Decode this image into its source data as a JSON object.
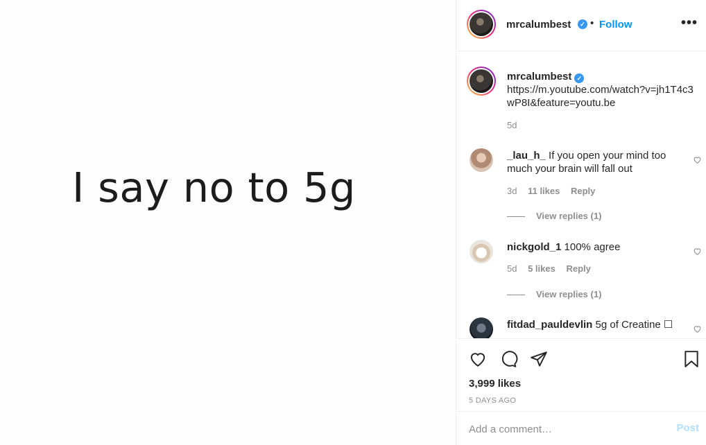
{
  "post": {
    "media_text": "I say no to 5g"
  },
  "header": {
    "username": "mrcalumbest",
    "separator": "•",
    "follow_label": "Follow",
    "more_label": "•••"
  },
  "caption": {
    "username": "mrcalumbest",
    "text": "https://m.youtube.com/watch?v=jh1T4c3wP8I&feature=youtu.be",
    "time": "5d"
  },
  "comments": [
    {
      "username": "_lau_h_",
      "text": "If you open your mind too much your brain will fall out",
      "time": "3d",
      "likes": "11 likes",
      "reply_label": "Reply",
      "view_replies": "View replies (1)"
    },
    {
      "username": "nickgold_1",
      "text": "100% agree",
      "time": "5d",
      "likes": "5 likes",
      "reply_label": "Reply",
      "view_replies": "View replies (1)"
    },
    {
      "username": "fitdad_pauldevlin",
      "text": "5g of Creatine ☐"
    }
  ],
  "stats": {
    "likes": "3,999 likes",
    "date": "5 DAYS AGO"
  },
  "composer": {
    "placeholder": "Add a comment…",
    "post_label": "Post"
  },
  "icons": {
    "verified": "verified-badge-icon",
    "like": "heart-icon",
    "comment": "comment-bubble-icon",
    "share": "paper-plane-icon",
    "save": "bookmark-icon",
    "comment_like": "small-heart-icon"
  },
  "colors": {
    "accent": "#0095f6",
    "verified": "#3897f0",
    "muted": "#8e8e8e",
    "post_disabled": "#b2dffc"
  }
}
